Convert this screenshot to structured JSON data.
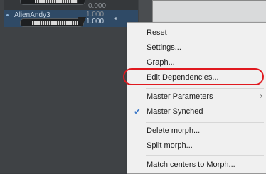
{
  "panel": {
    "top_value": "0.000",
    "morph": {
      "name": "AlienAndy3",
      "value_top": "1.000",
      "value_bottom": "1.000"
    }
  },
  "context_menu": {
    "items": [
      {
        "label": "Reset"
      },
      {
        "label": "Settings..."
      },
      {
        "label": "Graph..."
      },
      {
        "label": "Edit Dependencies...",
        "highlighted": true
      },
      {
        "label": "Master Parameters",
        "submenu": true
      },
      {
        "label": "Master Synched",
        "checked": true
      },
      {
        "label": "Delete morph..."
      },
      {
        "label": "Split morph..."
      },
      {
        "label": "Match centers to Morph..."
      }
    ]
  },
  "colors": {
    "highlight_ring": "#e0191f",
    "check": "#3c78c8"
  }
}
